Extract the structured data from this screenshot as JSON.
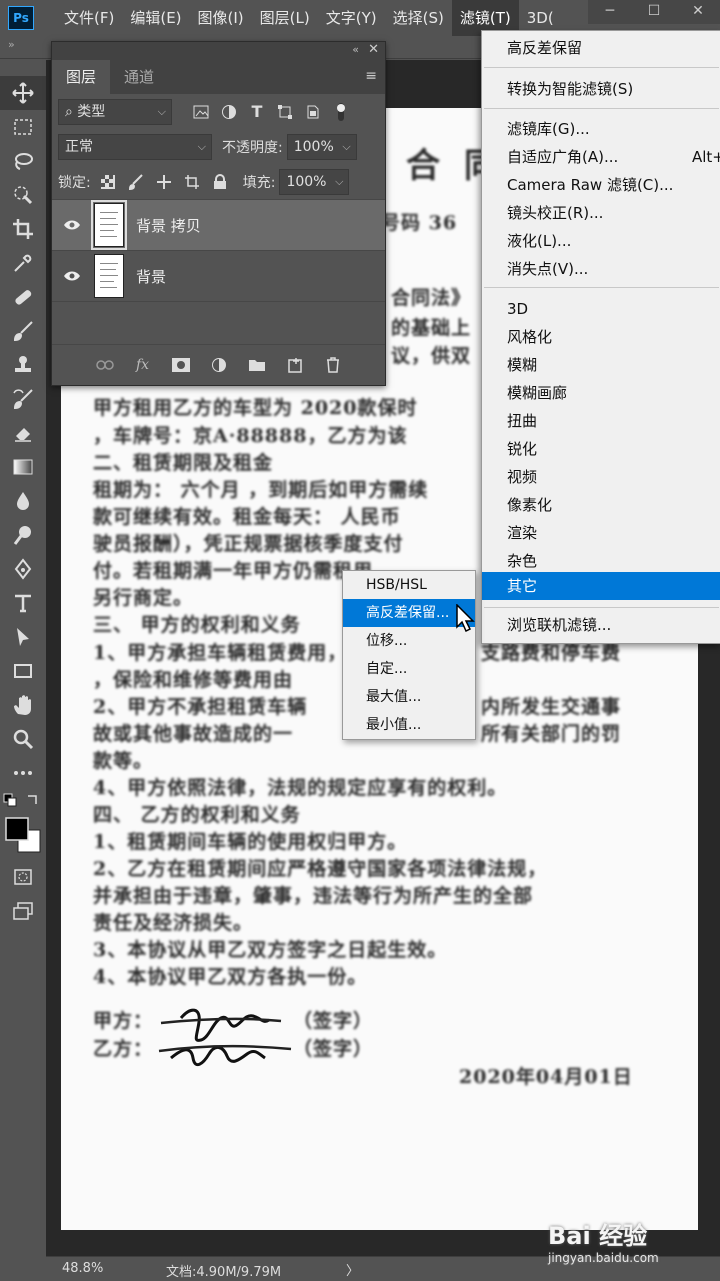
{
  "app": {
    "logo": "Ps"
  },
  "menubar": {
    "items": [
      "文件(F)",
      "编辑(E)",
      "图像(I)",
      "图层(L)",
      "文字(Y)",
      "选择(S)",
      "滤镜(T)",
      "3D("
    ],
    "window_buttons": [
      "─",
      "☐",
      "✕"
    ]
  },
  "optbar": {
    "collapse": "»"
  },
  "layers_panel": {
    "collapse": "«",
    "close": "✕",
    "tabs": [
      "图层",
      "通道"
    ],
    "menu_icon": "≡",
    "filter_kind": "类型",
    "blend_mode": "正常",
    "opacity_label": "不透明度:",
    "opacity_value": "100%",
    "lock_label": "锁定:",
    "fill_label": "填充:",
    "fill_value": "100%",
    "layers": [
      {
        "name": "背景 拷贝",
        "visible": true,
        "selected": true
      },
      {
        "name": "背景",
        "visible": true,
        "selected": false
      }
    ]
  },
  "filter_menu": {
    "items": [
      {
        "label": "高反差保留",
        "shortcut": ""
      },
      {
        "label": "转换为智能滤镜(S)",
        "shortcut": ""
      },
      {
        "label": "滤镜库(G)...",
        "shortcut": ""
      },
      {
        "label": "自适应广角(A)...",
        "shortcut": "Alt+"
      },
      {
        "label": "Camera Raw 滤镜(C)...",
        "shortcut": ""
      },
      {
        "label": "镜头校正(R)...",
        "shortcut": ""
      },
      {
        "label": "液化(L)...",
        "shortcut": ""
      },
      {
        "label": "消失点(V)...",
        "shortcut": ""
      },
      {
        "label": "3D",
        "shortcut": ""
      },
      {
        "label": "风格化",
        "shortcut": ""
      },
      {
        "label": "模糊",
        "shortcut": ""
      },
      {
        "label": "模糊画廊",
        "shortcut": ""
      },
      {
        "label": "扭曲",
        "shortcut": ""
      },
      {
        "label": "锐化",
        "shortcut": ""
      },
      {
        "label": "视频",
        "shortcut": ""
      },
      {
        "label": "像素化",
        "shortcut": ""
      },
      {
        "label": "渲染",
        "shortcut": ""
      },
      {
        "label": "杂色",
        "shortcut": ""
      },
      {
        "label": "其它",
        "shortcut": ""
      },
      {
        "label": "浏览联机滤镜...",
        "shortcut": ""
      }
    ]
  },
  "other_submenu": {
    "items": [
      "HSB/HSL",
      "高反差保留...",
      "位移...",
      "自定...",
      "最大值...",
      "最小值..."
    ]
  },
  "document": {
    "lines": [
      "合 同",
      "号码 36",
      "合同法》",
      "的基础上",
      "议，供双",
      "甲方租用乙方的车型为 2020款保时",
      "，车牌号：京A·88888，乙方为该",
      "二、租赁期限及租金",
      "租期为： 六个月 ，到期后如甲方需续",
      "款可继续有效。租金每天： 人民币",
      "驶员报酬），凭正规票据核季度支付",
      "付。若租期满一年甲方仍需租用，",
      "另行商定。",
      "三、 甲方的权利和义务",
      "1、甲方承担车辆租赁费用，",
      "，保险和维修等费用由",
      "2、甲方不承担租赁车辆",
      "故或其他事故造成的一",
      "款等。",
      "4、甲方依照法律，法规的规定应享有的权利。",
      "四、 乙方的权利和义务",
      "1、租赁期间车辆的使用权归甲方。",
      "2、乙方在租赁期间应严格遵守国家各项法律法规，",
      "并承担由于违章，肇事，违法等行为所产生的全部",
      "责任及经济损失。",
      "3、本协议从甲乙双方签字之日起生效。",
      "4、本协议甲乙双方各执一份。",
      "甲方：",
      "（签字）",
      "乙方：",
      "（签字）",
      "2020年04月01日"
    ],
    "right_fragments": [
      "支路费和停车费",
      "内所发生交通事",
      "所有关部门的罚"
    ]
  },
  "statusbar": {
    "zoom": "48.8%",
    "doc": "文档:4.90M/9.79M",
    "chevron": "〉"
  },
  "watermark": {
    "brand": "Bai 经验",
    "url": "jingyan.baidu.com"
  }
}
